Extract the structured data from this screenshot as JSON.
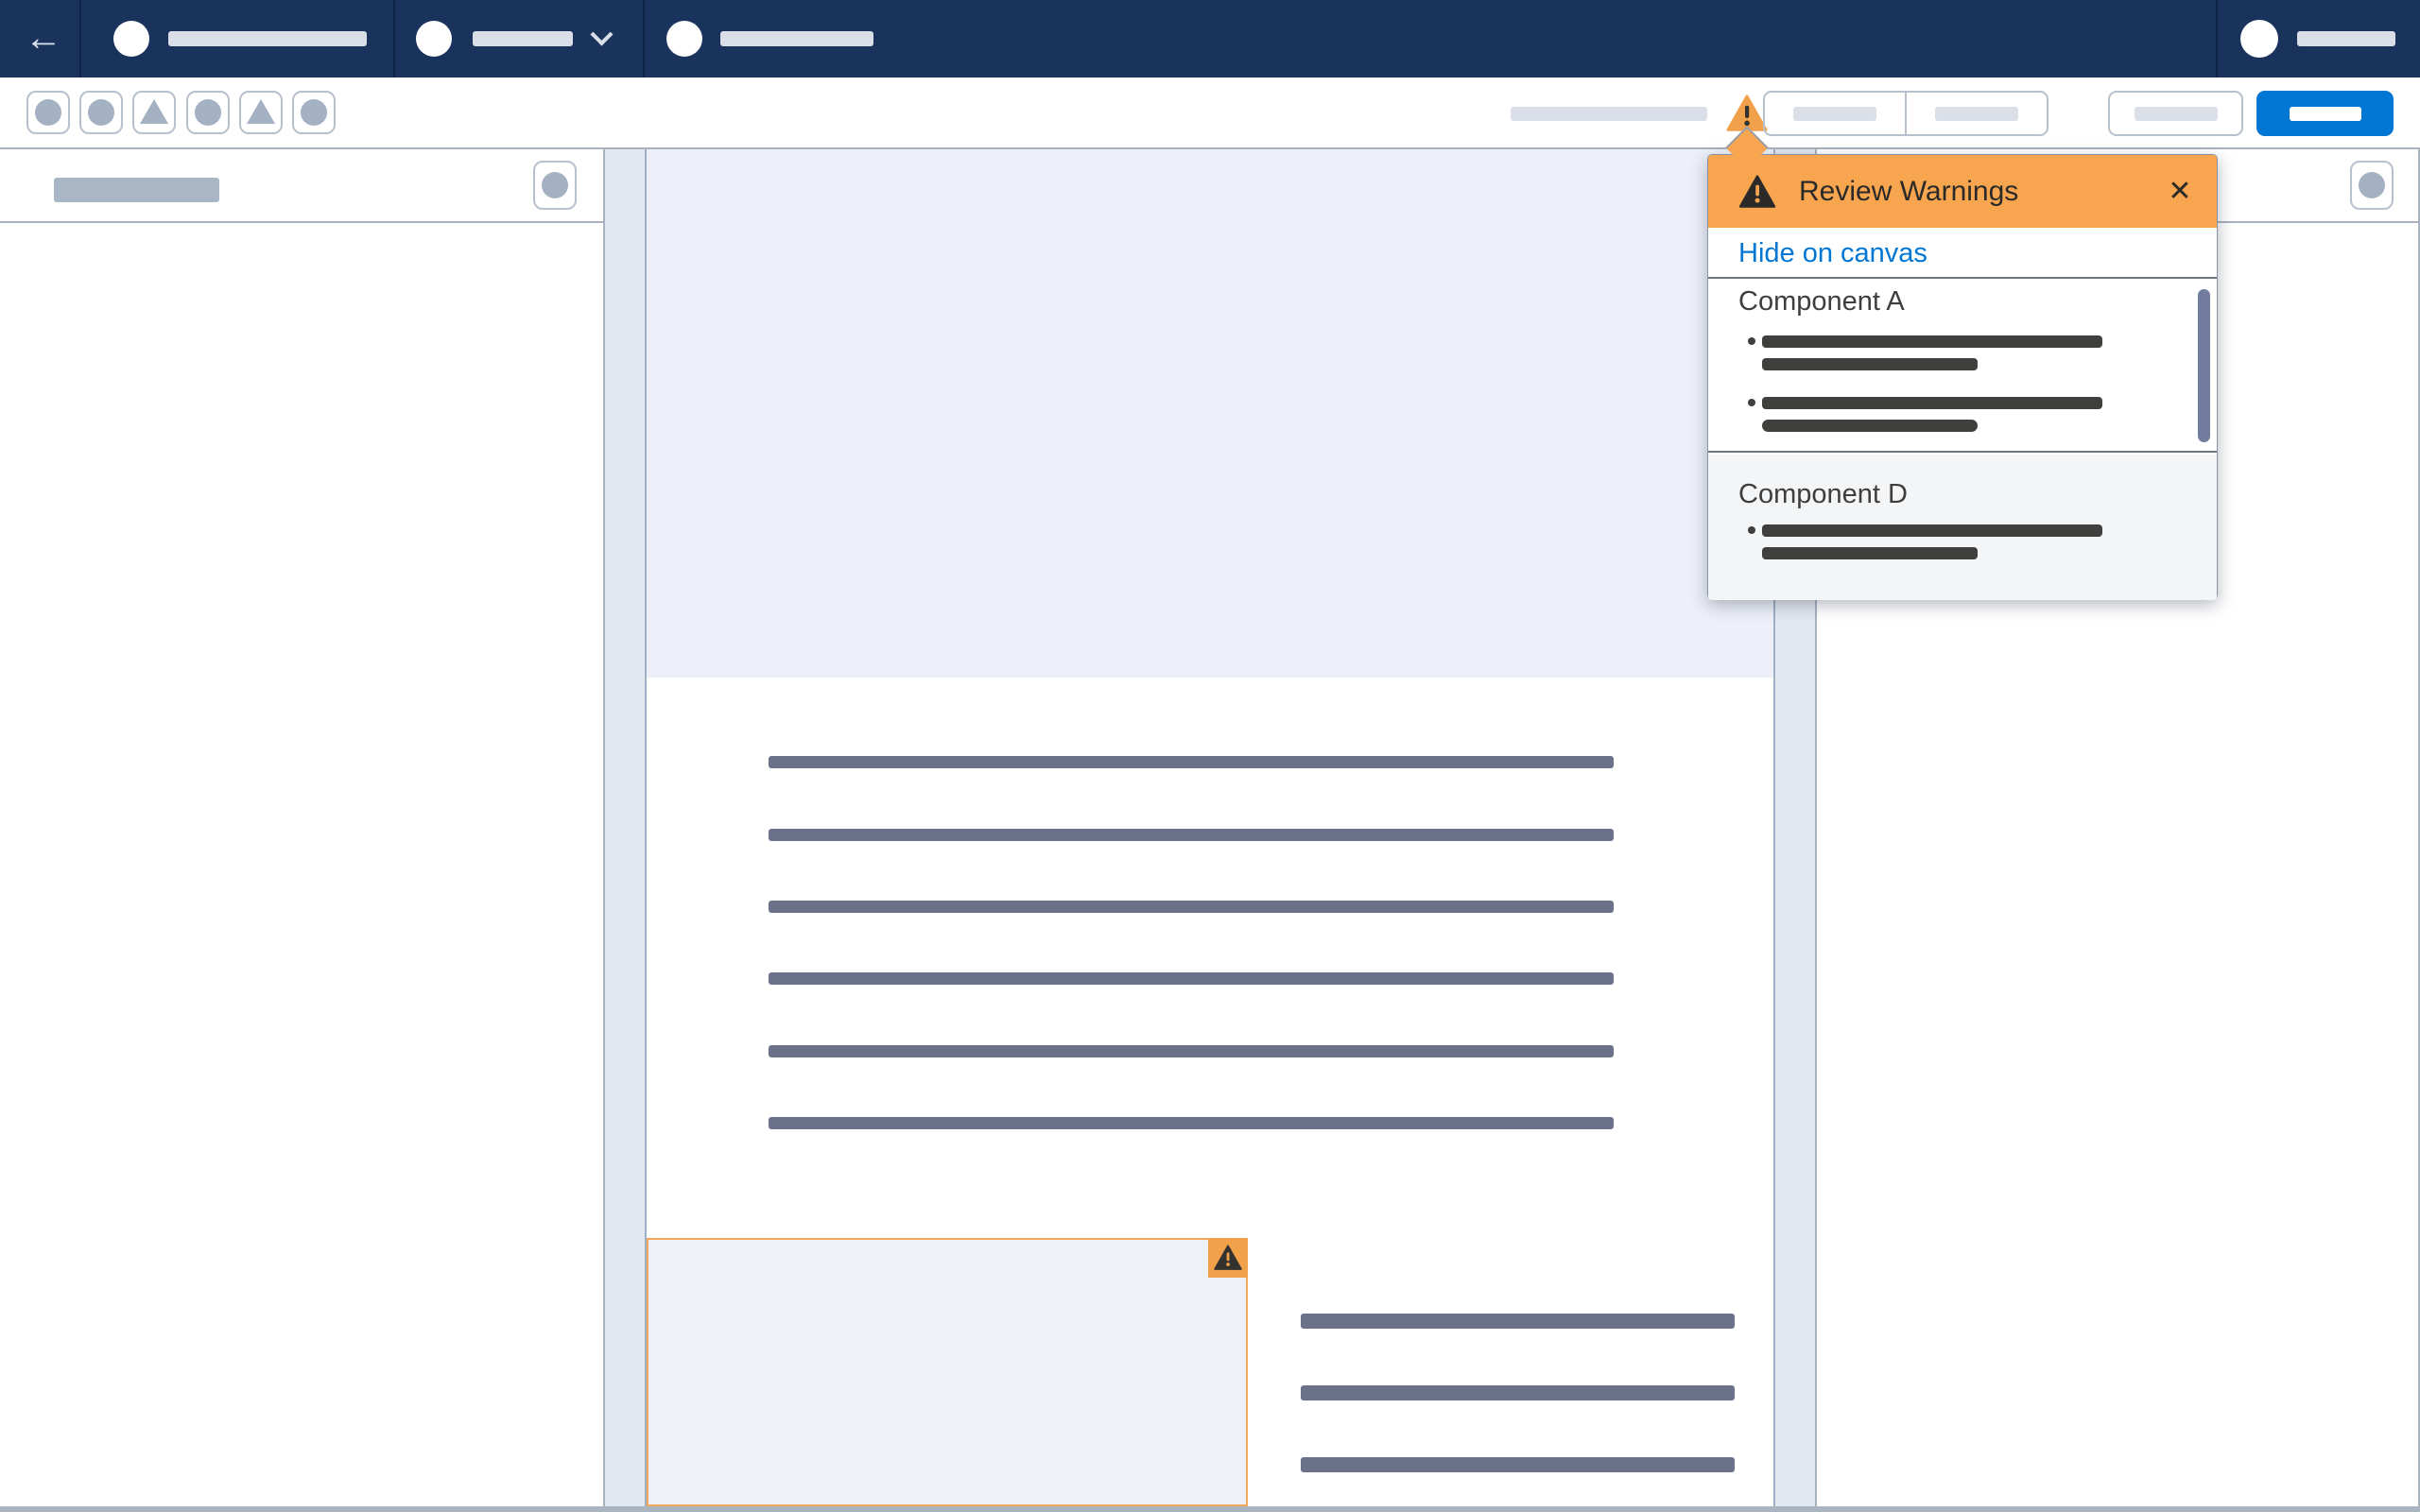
{
  "colors": {
    "topbar_bg": "#1a335d",
    "warning_orange": "#f2a14b",
    "popover_header_orange": "#f7a54e",
    "brand_blue": "#0176d3",
    "link_blue": "#0176d3",
    "placeholder_light": "#d9dee8",
    "placeholder_slate": "#6a7189",
    "bullet_dark": "#3f3f3d",
    "panel_border": "#a8b2bf",
    "hero_bg": "#edf0f8",
    "stage_bg": "#e3e8f0",
    "scrollbar": "#727c9d"
  },
  "topbar": {
    "back_glyph": "←",
    "items": [
      "app-menu-placeholder",
      "workspace-selector-placeholder",
      "page-selector-placeholder",
      "user-avatar-placeholder"
    ]
  },
  "toolbar": {
    "left_buttons": [
      "circle-icon",
      "circle-icon",
      "triangle-icon",
      "circle-icon",
      "triangle-icon",
      "circle-icon"
    ],
    "warning_icon": "warning-triangle",
    "right_buttons": [
      "segmented-placeholder-1",
      "segmented-placeholder-2",
      "outline-placeholder",
      "primary-blue-placeholder"
    ]
  },
  "popover": {
    "title": "Review Warnings",
    "close_glyph": "✕",
    "hide_link": "Hide on canvas",
    "sections": [
      {
        "title": "Component A",
        "bullet_count": 2
      },
      {
        "title": "Component D",
        "bullet_count": 1
      }
    ]
  },
  "canvas": {
    "hero": "hero-image-placeholder",
    "body_line_count": 6,
    "flagged_component": {
      "badge_icon": "warning-triangle",
      "side_line_count": 3
    }
  }
}
